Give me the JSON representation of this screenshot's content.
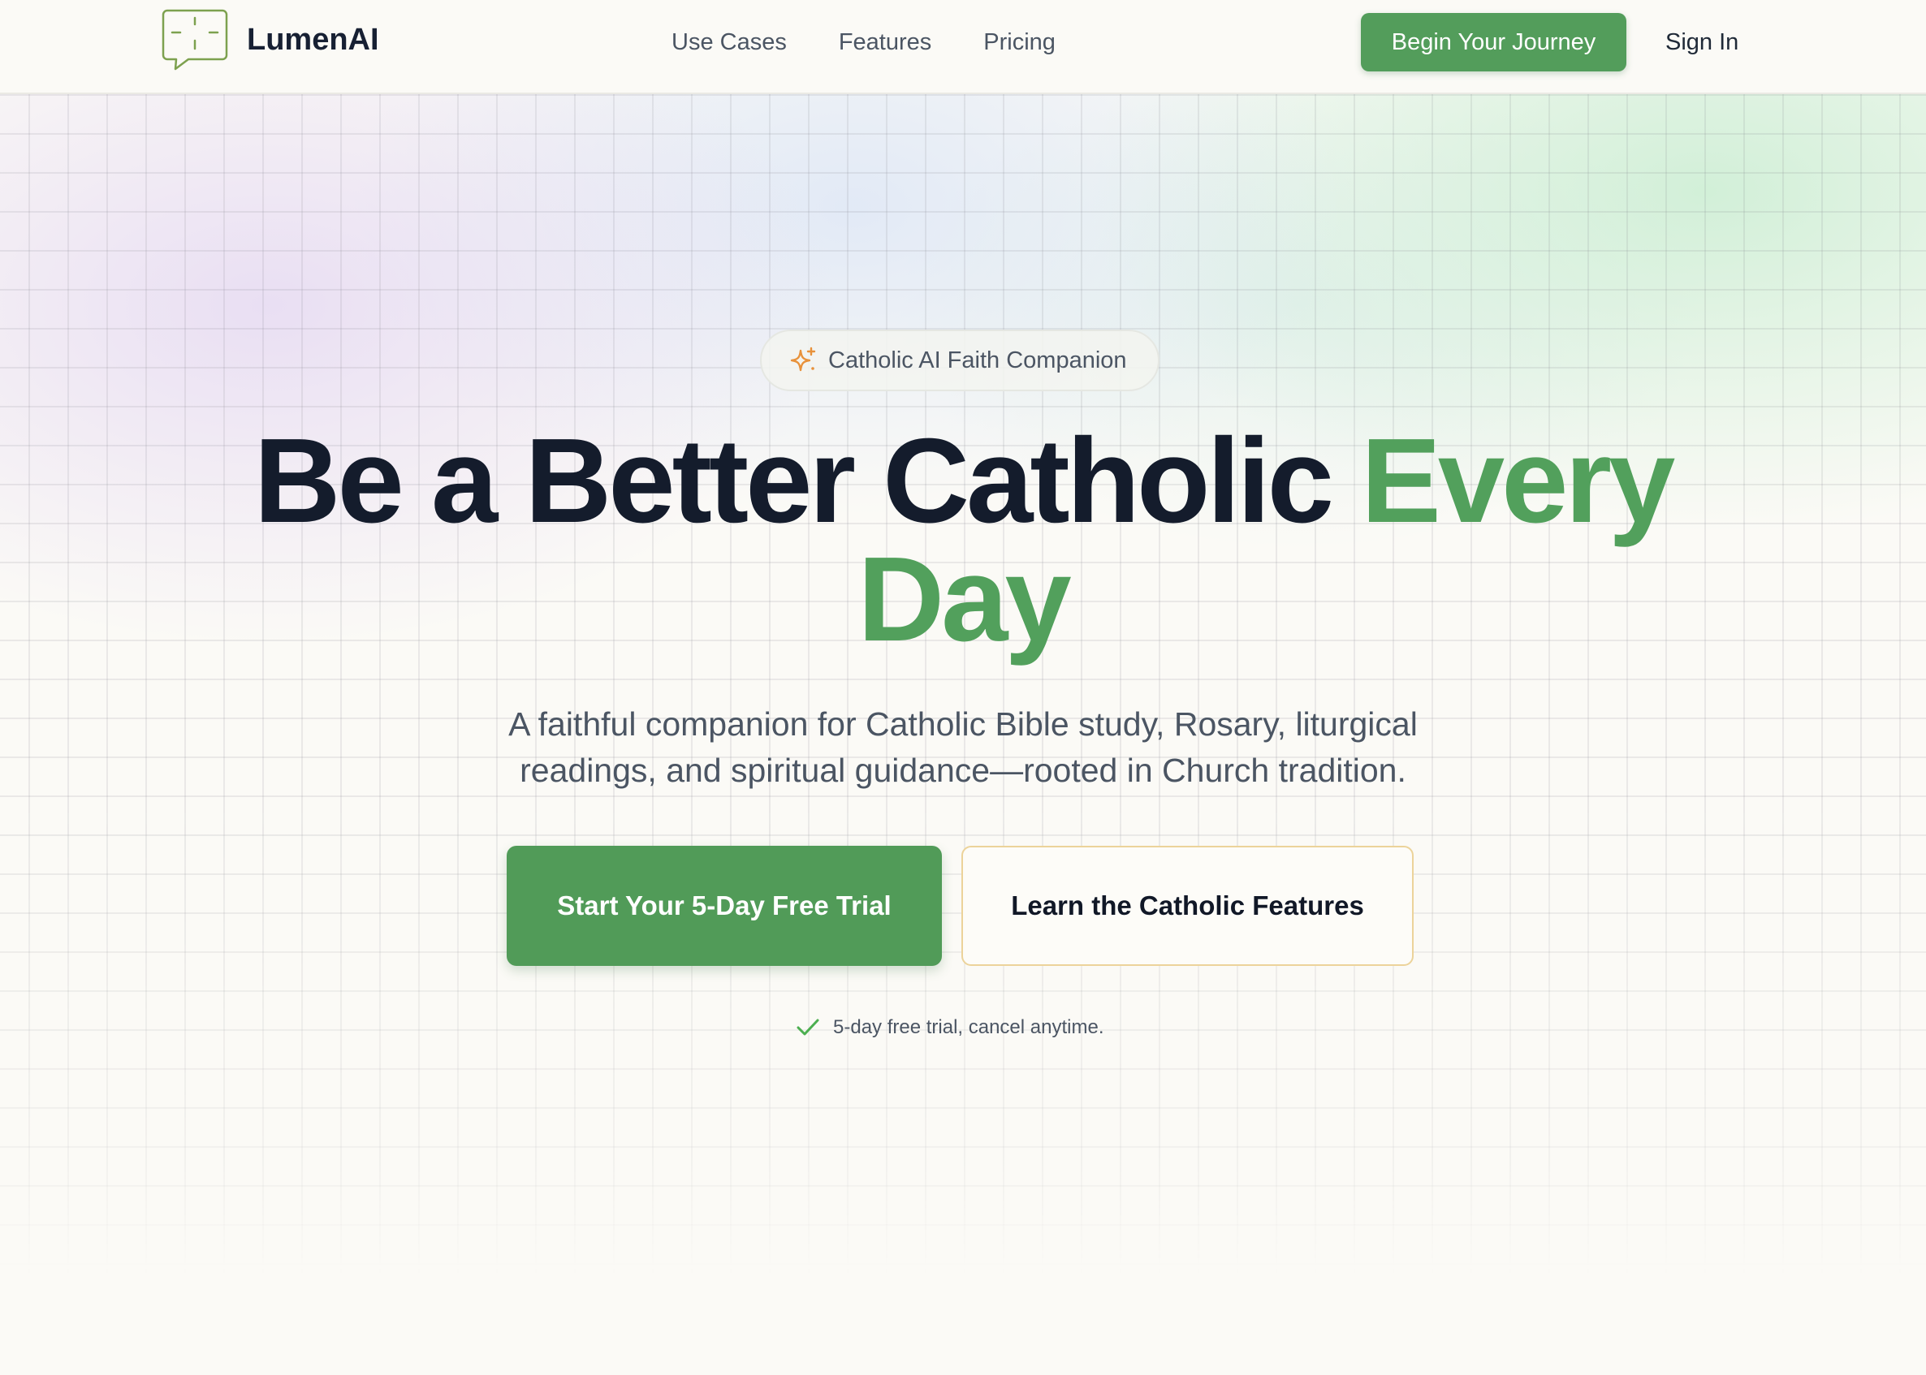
{
  "header": {
    "brand": "LumenAI",
    "logo_icon": "chat-bubble-crosshair-icon",
    "nav": [
      {
        "label": "Use Cases"
      },
      {
        "label": "Features"
      },
      {
        "label": "Pricing"
      }
    ],
    "cta_label": "Begin Your Journey",
    "signin_label": "Sign In"
  },
  "hero": {
    "badge": {
      "icon": "sparkle-icon",
      "text": "Catholic AI Faith Companion"
    },
    "headline_main": "Be a Better Catholic ",
    "headline_accent_1": "Every",
    "headline_accent_2": "Day",
    "subtitle": "A faithful companion for Catholic Bible study, Rosary, liturgical readings, and spiritual guidance—rooted in Church tradition.",
    "primary_button": "Start Your 5-Day Free Trial",
    "secondary_button": "Learn the Catholic Features",
    "trial_note": {
      "icon": "check-icon",
      "text": "5-day free trial, cancel anytime."
    }
  },
  "colors": {
    "accent_green": "#52a05c",
    "button_green": "#519b58",
    "headline_dark": "#141c2c",
    "secondary_border": "#ecd39a",
    "sparkle_orange": "#e8913a",
    "background": "#fbfaf6"
  }
}
